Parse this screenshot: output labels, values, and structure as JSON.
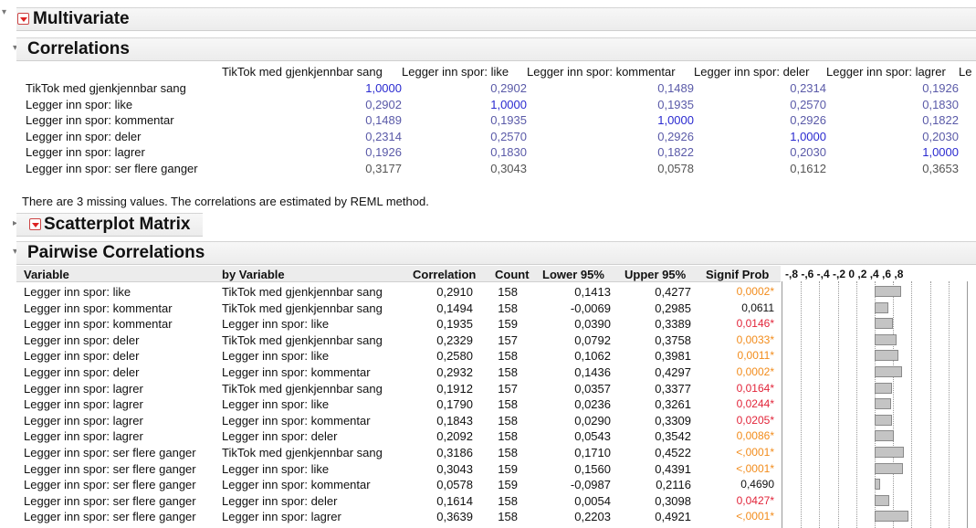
{
  "report": {
    "title": "Multivariate",
    "correlations": {
      "title": "Correlations",
      "columns": [
        "TikTok med gjenkjennbar sang",
        "Legger inn spor: like",
        "Legger inn spor: kommentar",
        "Legger inn spor: deler",
        "Legger inn spor: lagrer",
        "Le"
      ],
      "rows": [
        {
          "label": "TikTok med gjenkjennbar sang",
          "values": [
            "1,0000",
            "0,2902",
            "0,1489",
            "0,2314",
            "0,1926"
          ]
        },
        {
          "label": "Legger inn spor: like",
          "values": [
            "0,2902",
            "1,0000",
            "0,1935",
            "0,2570",
            "0,1830"
          ]
        },
        {
          "label": "Legger inn spor: kommentar",
          "values": [
            "0,1489",
            "0,1935",
            "1,0000",
            "0,2926",
            "0,1822"
          ]
        },
        {
          "label": "Legger inn spor: deler",
          "values": [
            "0,2314",
            "0,2570",
            "0,2926",
            "1,0000",
            "0,2030"
          ]
        },
        {
          "label": "Legger inn spor: lagrer",
          "values": [
            "0,1926",
            "0,1830",
            "0,1822",
            "0,2030",
            "1,0000"
          ]
        },
        {
          "label": "Legger inn spor: ser flere ganger",
          "values": [
            "0,3177",
            "0,3043",
            "0,0578",
            "0,1612",
            "0,3653"
          ]
        }
      ],
      "note": "There are 3 missing values. The correlations are estimated by REML method."
    },
    "scatterplot_matrix": {
      "title": "Scatterplot Matrix"
    },
    "pairwise": {
      "title": "Pairwise Correlations",
      "headers": {
        "variable": "Variable",
        "by_variable": "by Variable",
        "correlation": "Correlation",
        "count": "Count",
        "lower": "Lower 95%",
        "upper": "Upper 95%",
        "signif": "Signif Prob",
        "scale": "-,8 -,6 -,4 -,2  0  ,2  ,4  ,6  ,8"
      },
      "rows": [
        {
          "variable": "Legger inn spor: like",
          "by": "TikTok med gjenkjennbar sang",
          "corr": "0,2910",
          "count": "158",
          "lower": "0,1413",
          "upper": "0,4277",
          "p": "0,0002*",
          "p_color": "orange",
          "r": 0.291
        },
        {
          "variable": "Legger inn spor: kommentar",
          "by": "TikTok med gjenkjennbar sang",
          "corr": "0,1494",
          "count": "158",
          "lower": "-0,0069",
          "upper": "0,2985",
          "p": "0,0611",
          "p_color": "black",
          "r": 0.1494
        },
        {
          "variable": "Legger inn spor: kommentar",
          "by": "Legger inn spor: like",
          "corr": "0,1935",
          "count": "159",
          "lower": "0,0390",
          "upper": "0,3389",
          "p": "0,0146*",
          "p_color": "red",
          "r": 0.1935
        },
        {
          "variable": "Legger inn spor: deler",
          "by": "TikTok med gjenkjennbar sang",
          "corr": "0,2329",
          "count": "157",
          "lower": "0,0792",
          "upper": "0,3758",
          "p": "0,0033*",
          "p_color": "orange",
          "r": 0.2329
        },
        {
          "variable": "Legger inn spor: deler",
          "by": "Legger inn spor: like",
          "corr": "0,2580",
          "count": "158",
          "lower": "0,1062",
          "upper": "0,3981",
          "p": "0,0011*",
          "p_color": "orange",
          "r": 0.258
        },
        {
          "variable": "Legger inn spor: deler",
          "by": "Legger inn spor: kommentar",
          "corr": "0,2932",
          "count": "158",
          "lower": "0,1436",
          "upper": "0,4297",
          "p": "0,0002*",
          "p_color": "orange",
          "r": 0.2932
        },
        {
          "variable": "Legger inn spor: lagrer",
          "by": "TikTok med gjenkjennbar sang",
          "corr": "0,1912",
          "count": "157",
          "lower": "0,0357",
          "upper": "0,3377",
          "p": "0,0164*",
          "p_color": "red",
          "r": 0.1912
        },
        {
          "variable": "Legger inn spor: lagrer",
          "by": "Legger inn spor: like",
          "corr": "0,1790",
          "count": "158",
          "lower": "0,0236",
          "upper": "0,3261",
          "p": "0,0244*",
          "p_color": "red",
          "r": 0.179
        },
        {
          "variable": "Legger inn spor: lagrer",
          "by": "Legger inn spor: kommentar",
          "corr": "0,1843",
          "count": "158",
          "lower": "0,0290",
          "upper": "0,3309",
          "p": "0,0205*",
          "p_color": "red",
          "r": 0.1843
        },
        {
          "variable": "Legger inn spor: lagrer",
          "by": "Legger inn spor: deler",
          "corr": "0,2092",
          "count": "158",
          "lower": "0,0543",
          "upper": "0,3542",
          "p": "0,0086*",
          "p_color": "orange",
          "r": 0.2092
        },
        {
          "variable": "Legger inn spor: ser flere ganger",
          "by": "TikTok med gjenkjennbar sang",
          "corr": "0,3186",
          "count": "158",
          "lower": "0,1710",
          "upper": "0,4522",
          "p": "<,0001*",
          "p_color": "orange",
          "r": 0.3186
        },
        {
          "variable": "Legger inn spor: ser flere ganger",
          "by": "Legger inn spor: like",
          "corr": "0,3043",
          "count": "159",
          "lower": "0,1560",
          "upper": "0,4391",
          "p": "<,0001*",
          "p_color": "orange",
          "r": 0.3043
        },
        {
          "variable": "Legger inn spor: ser flere ganger",
          "by": "Legger inn spor: kommentar",
          "corr": "0,0578",
          "count": "159",
          "lower": "-0,0987",
          "upper": "0,2116",
          "p": "0,4690",
          "p_color": "black",
          "r": 0.0578
        },
        {
          "variable": "Legger inn spor: ser flere ganger",
          "by": "Legger inn spor: deler",
          "corr": "0,1614",
          "count": "158",
          "lower": "0,0054",
          "upper": "0,3098",
          "p": "0,0427*",
          "p_color": "red",
          "r": 0.1614
        },
        {
          "variable": "Legger inn spor: ser flere ganger",
          "by": "Legger inn spor: lagrer",
          "corr": "0,3639",
          "count": "158",
          "lower": "0,2203",
          "upper": "0,4921",
          "p": "<,0001*",
          "p_color": "orange",
          "r": 0.3639
        }
      ]
    },
    "colors": {
      "blue": "#2a2ad0",
      "orange": "#f28c1c",
      "red": "#e2253a"
    }
  }
}
